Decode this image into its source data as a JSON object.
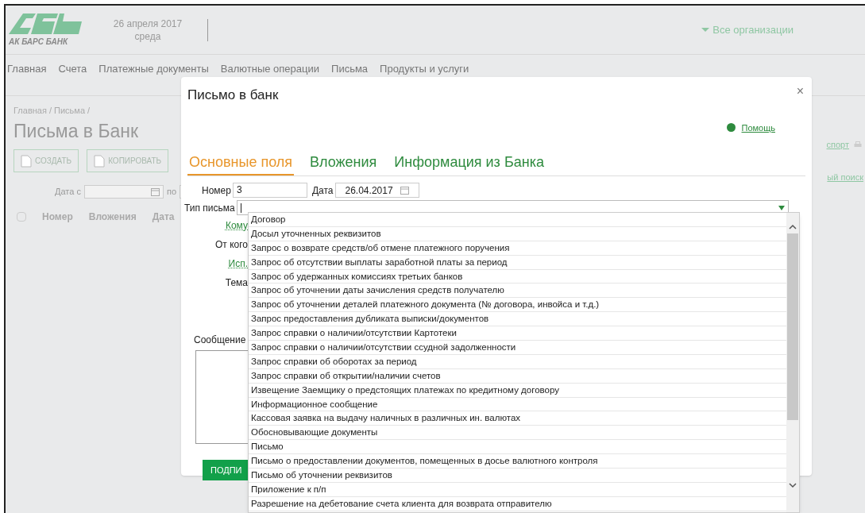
{
  "header": {
    "bank_name": "АК БАРС БАНК",
    "date": "26 апреля 2017",
    "weekday": "среда",
    "org_selector": "Все организации"
  },
  "nav": [
    {
      "label": "Главная"
    },
    {
      "label": "Счета"
    },
    {
      "label": "Платежные документы"
    },
    {
      "label": "Валютные операции"
    },
    {
      "label": "Письма"
    },
    {
      "label": "Продукты и услуги"
    }
  ],
  "page": {
    "breadcrumb": "Главная / Письма /",
    "title": "Письма в Банк",
    "toolbar": [
      "СОЗДАТЬ",
      "КОПИРОВАТЬ"
    ],
    "export_link": "спорт",
    "search_link": "ый поиск",
    "date_from_label": "Дата с",
    "date_to_label": "по",
    "columns": [
      "Номер",
      "Вложения",
      "Дата"
    ],
    "select_all_checked": false
  },
  "dialog": {
    "title": "Письмо в банк",
    "close": "×",
    "help": "Помощь",
    "tabs": [
      {
        "label": "Основные поля",
        "selected": true
      },
      {
        "label": "Вложения",
        "selected": false
      },
      {
        "label": "Информация из Банка",
        "selected": false
      }
    ],
    "number_label": "Номер",
    "number_value": "3",
    "date_label": "Дата",
    "date_value": "26.04.2017",
    "type_label": "Тип письма",
    "side_labels": [
      {
        "label": "Кому",
        "link": true
      },
      {
        "label": "От кого",
        "link": false
      },
      {
        "label": "Исп.",
        "link": true
      },
      {
        "label": "Тема",
        "link": false
      }
    ],
    "message_label": "Сообщение",
    "sign_button": "ПОДПИ",
    "type_options": [
      "Договор",
      "Досыл уточненных реквизитов",
      "Запрос о возврате средств/об отмене платежного поручения",
      "Запрос об отсутствии выплаты заработной платы за период",
      "Запрос об удержанных комиссиях третьих банков",
      "Запрос об уточнении даты зачисления средств получателю",
      "Запрос об уточнении деталей платежного документа (№ договора, инвойса и т.д.)",
      "Запрос предоставления дубликата выписки/документов",
      "Запрос справки о наличии/отсутствии Картотеки",
      "Запрос справки о наличии/отсутствии ссудной задолженности",
      "Запрос справки об оборотах за период",
      "Запрос справки об открытии/наличии счетов",
      "Извещение Заемщику о предстоящих платежах по кредитному договору",
      "Информационное сообщение",
      "Кассовая заявка на выдачу наличных в различных ин. валютах",
      "Обосновывающие документы",
      "Письмо",
      "Письмо о предоставлении документов, помещенных в досье валютного контроля",
      "Письмо об уточнении реквизитов",
      "Приложение к п/п",
      "Разрешение на дебетование счета клиента для возврата отправителю"
    ]
  }
}
